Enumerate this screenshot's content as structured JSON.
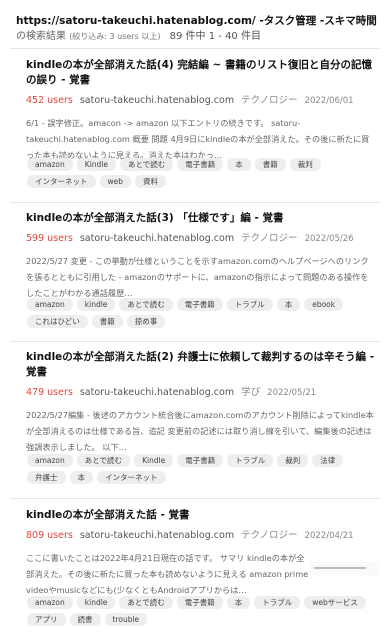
{
  "header": {
    "query": "https://satoru-takeuchi.hatenablog.com/ -タスク管理 -スキマ時間",
    "suffix": "の検索結果",
    "filter": "(絞り込み: 3 users 以上)",
    "result_count": "89 件中 1 - 40 件目"
  },
  "entries": [
    {
      "title": "kindleの本が全部消えた話(4) 完結編 ~ 書籍のリスト復旧と自分の記憶の誤り - 覚書",
      "users": "452 users",
      "domain": "satoru-takeuchi.hatenablog.com",
      "category": "テクノロジー",
      "date": "2022/06/01",
      "description": "6/1 - 誤字修正。amacon -> amazon 以下エントリの続きです。 satoru-takeuchi.hatenablog.com 概要 問題 4月9日にkindleの本が全部消えた。その後に新たに買った本も読めないように見える。消えた本はわかっ…",
      "tags": [
        "amazon",
        "Kindle",
        "あとで読む",
        "電子書籍",
        "本",
        "書籍",
        "裁判",
        "インターネット",
        "web",
        "資料"
      ]
    },
    {
      "title": "kindleの本が全部消えた話(3) 「仕様です」編 - 覚書",
      "users": "599 users",
      "domain": "satoru-takeuchi.hatenablog.com",
      "category": "テクノロジー",
      "date": "2022/05/26",
      "description": "2022/5/27 変更 - この挙動が仕様ということを示すamazon.comのヘルプページへのリンクを張るとともに引用した - amazonのサポートに、amazonの指示によって問題のある操作をしたことがわかる通話履歴…",
      "tags": [
        "amazon",
        "kindle",
        "あとで読む",
        "電子書籍",
        "トラブル",
        "本",
        "ebook",
        "これはひどい",
        "書籍",
        "掠め事"
      ]
    },
    {
      "title": "kindleの本が全部消えた話(2) 弁護士に依頼して裁判するのは辛そう編 - 覚書",
      "users": "479 users",
      "domain": "satoru-takeuchi.hatenablog.com",
      "category": "学び",
      "date": "2022/05/21",
      "description": "2022/5/27編集 - 後述のアカウント統合後にamazon.comのアカウント削除によってkindle本が全部消えるのは仕様である旨、追記 変更前の記述には取り消し線を引いて、編集後の記述は強調表示しました。 以下…",
      "tags": [
        "amazon",
        "あとで読む",
        "Kindle",
        "電子書籍",
        "トラブル",
        "裁判",
        "法律",
        "弁護士",
        "本",
        "インターネット"
      ]
    },
    {
      "title": "kindleの本が全部消えた話 - 覚書",
      "users": "809 users",
      "domain": "satoru-takeuchi.hatenablog.com",
      "category": "テクノロジー",
      "date": "2022/04/21",
      "description": "ここに書いたことは2022年4月21日現在の話です。 サマリ kindleの本が全部消えた。その後に新たに買った本も読めないように見える amazon prime videoやmusicなどにも(少なくともAndroidアプリからは…",
      "tags": [
        "amazon",
        "kindle",
        "あとで読む",
        "電子書籍",
        "本",
        "トラブル",
        "webサービス",
        "アプリ",
        "読書",
        "trouble"
      ]
    }
  ]
}
